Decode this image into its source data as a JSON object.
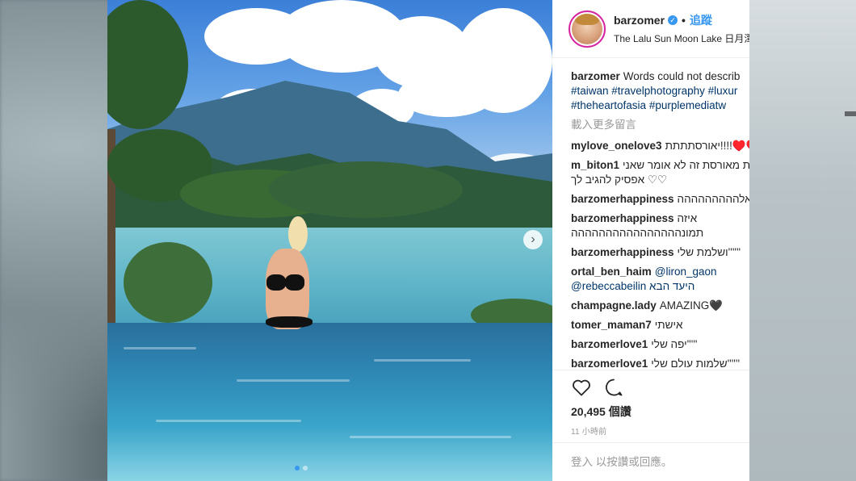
{
  "post": {
    "username": "barzomer",
    "verified_icon": "check-icon",
    "separator": "•",
    "follow_label": "追蹤",
    "location": "The Lalu Sun Moon Lake 日月潭"
  },
  "caption": {
    "user": "barzomer",
    "text": "Words could not describ",
    "hashtags_line1": "#taiwan #travelphotography #luxur",
    "hashtags_line2": "#theheartofasia #purplemediatw"
  },
  "load_more": "載入更多留言",
  "comments": [
    {
      "user": "mylove_onelove3",
      "text": "יאורסתתתת!!!!♥️♥️"
    },
    {
      "user": "m_biton1",
      "text": "ת מאורסת זה לא אומר שאני",
      "text2": "אפסיק להגיב לך ♡♡"
    },
    {
      "user": "barzomerhappiness",
      "text": "מאלההההההההה"
    },
    {
      "user": "barzomerhappiness",
      "text": "איזה",
      "text2": "תמונהההההההההההההההה"
    },
    {
      "user": "barzomerhappiness",
      "text": "ושלמת שלי''''''"
    },
    {
      "user": "ortal_ben_haim",
      "text": "@liron_gaon",
      "text2": "@rebeccabeilin היעד הבא"
    },
    {
      "user": "champagne.lady",
      "text": "AMAZING🖤"
    },
    {
      "user": "tomer_maman7",
      "text": "אישתי"
    },
    {
      "user": "barzomerlove1",
      "text": "יפה שלי'''''"
    },
    {
      "user": "barzomerlove1",
      "text": "שלמות עולם שלי''''''"
    }
  ],
  "likes": "20,495 個讚",
  "time": "11 小時前",
  "login_prompt": "登入 以按讚或回應。",
  "colors": {
    "accent": "#3897f0",
    "muted": "#999999",
    "hashtag": "#003569"
  }
}
